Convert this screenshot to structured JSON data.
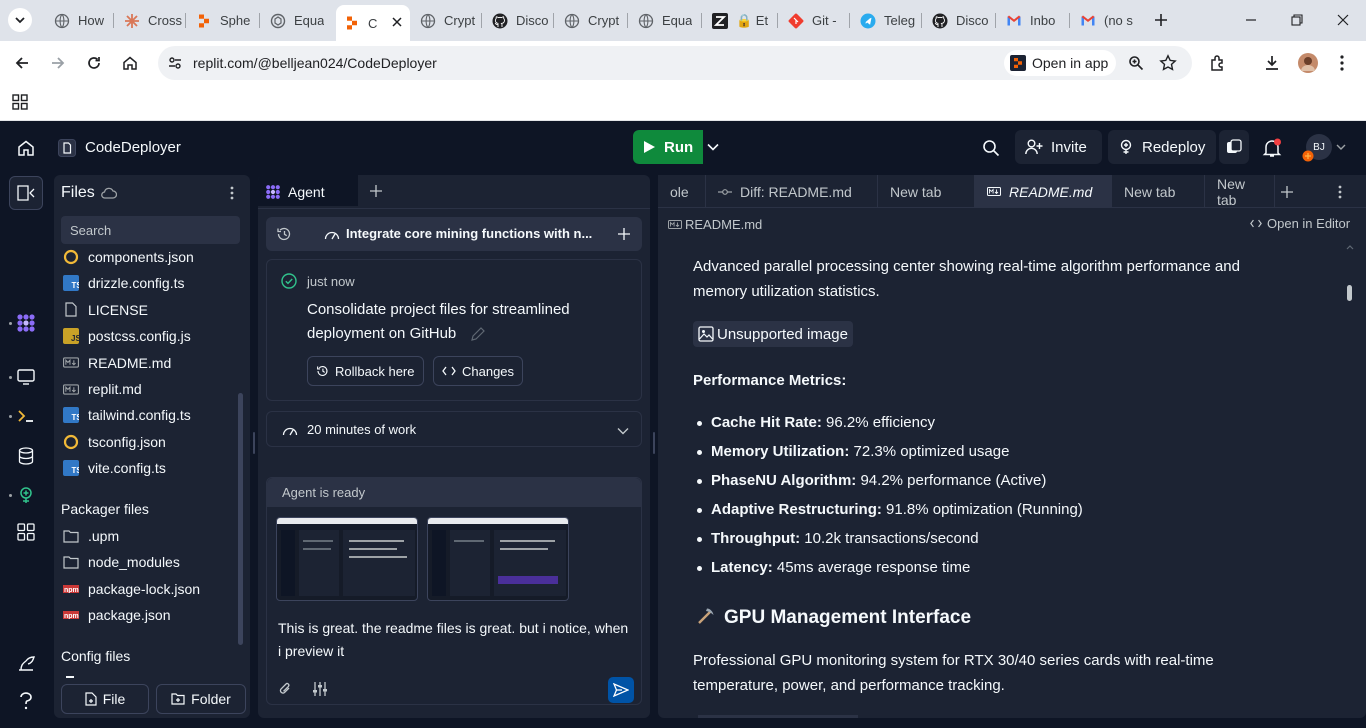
{
  "browser": {
    "tabs": [
      {
        "title": "How",
        "icon": "globe-icon",
        "color": "#5f6368"
      },
      {
        "title": "Cross",
        "icon": "claude-icon",
        "color": "#d97757"
      },
      {
        "title": "Sphe",
        "icon": "replit-icon",
        "color": "#f26207"
      },
      {
        "title": "Equa",
        "icon": "chatgpt-icon",
        "color": "#5f6368"
      },
      {
        "title": "C",
        "icon": "replit-icon",
        "color": "#f26207",
        "active": true
      },
      {
        "title": "Crypt",
        "icon": "globe-icon",
        "color": "#5f6368"
      },
      {
        "title": "Disco",
        "icon": "github-icon",
        "color": "#202124"
      },
      {
        "title": "Crypt",
        "icon": "globe-icon",
        "color": "#5f6368"
      },
      {
        "title": "Equa",
        "icon": "globe-icon",
        "color": "#5f6368"
      },
      {
        "title": "🔒 Et",
        "icon": "zed-icon",
        "color": "#202124"
      },
      {
        "title": "Git -",
        "icon": "git-icon",
        "color": "#f03c2e"
      },
      {
        "title": "Teleg",
        "icon": "telegram-icon",
        "color": "#2aabee"
      },
      {
        "title": "Disco",
        "icon": "github-icon",
        "color": "#202124"
      },
      {
        "title": "Inbo",
        "icon": "gmail-icon",
        "color": "#ea4335"
      },
      {
        "title": "(no s",
        "icon": "gmail-icon",
        "color": "#ea4335"
      }
    ],
    "url": "replit.com/@belljean024/CodeDeployer",
    "open_in_app": "Open in app"
  },
  "replit": {
    "project_name": "CodeDeployer",
    "run_label": "Run",
    "invite_label": "Invite",
    "redeploy_label": "Redeploy",
    "avatar_initials": "BJ",
    "accent": "#0f8a3c"
  },
  "files": {
    "title": "Files",
    "search_placeholder": "Search",
    "items": [
      {
        "name": "components.json",
        "type": "json"
      },
      {
        "name": "drizzle.config.ts",
        "type": "ts"
      },
      {
        "name": "LICENSE",
        "type": "file"
      },
      {
        "name": "postcss.config.js",
        "type": "js"
      },
      {
        "name": "README.md",
        "type": "md"
      },
      {
        "name": "replit.md",
        "type": "md"
      },
      {
        "name": "tailwind.config.ts",
        "type": "ts"
      },
      {
        "name": "tsconfig.json",
        "type": "json"
      },
      {
        "name": "vite.config.ts",
        "type": "ts"
      }
    ],
    "packager_title": "Packager files",
    "packager_items": [
      {
        "name": ".upm",
        "type": "folder"
      },
      {
        "name": "node_modules",
        "type": "folder"
      },
      {
        "name": "package-lock.json",
        "type": "npm"
      },
      {
        "name": "package.json",
        "type": "npm"
      }
    ],
    "config_title": "Config files",
    "new_file_label": "File",
    "new_folder_label": "Folder"
  },
  "agent": {
    "tab_label": "Agent",
    "task_title": "Integrate core mining functions with n...",
    "checkpoint_time": "just now",
    "checkpoint_message": "Consolidate project files for streamlined deployment on GitHub",
    "rollback_label": "Rollback here",
    "changes_label": "Changes",
    "work_summary": "20 minutes of work",
    "status": "Agent is ready",
    "input_text": "This is great. the readme files is great. but i notice, when i preview it"
  },
  "preview": {
    "tabs": [
      {
        "label": "ole"
      },
      {
        "label": "Diff: README.md"
      },
      {
        "label": "New tab"
      },
      {
        "label": "README.md",
        "active": true
      },
      {
        "label": "New tab"
      },
      {
        "label": "New tab"
      }
    ],
    "file_label": "README.md",
    "open_in_editor": "Open in Editor",
    "intro": "Advanced parallel processing center showing real-time algorithm performance and memory utilization statistics.",
    "unsupported_image": "Unsupported image",
    "metrics_heading": "Performance Metrics:",
    "metrics": [
      {
        "label": "Cache Hit Rate:",
        "value": " 96.2% efficiency"
      },
      {
        "label": "Memory Utilization:",
        "value": " 72.3% optimized usage"
      },
      {
        "label": "PhaseNU Algorithm:",
        "value": " 94.2% performance (Active)"
      },
      {
        "label": "Adaptive Restructuring:",
        "value": " 91.8% optimization (Running)"
      },
      {
        "label": "Throughput:",
        "value": " 10.2k transactions/second"
      },
      {
        "label": "Latency:",
        "value": " 45ms average response time"
      }
    ],
    "gpu_heading": "GPU Management Interface",
    "gpu_text": "Professional GPU monitoring system for RTX 30/40 series cards with real-time temperature, power, and performance tracking."
  }
}
